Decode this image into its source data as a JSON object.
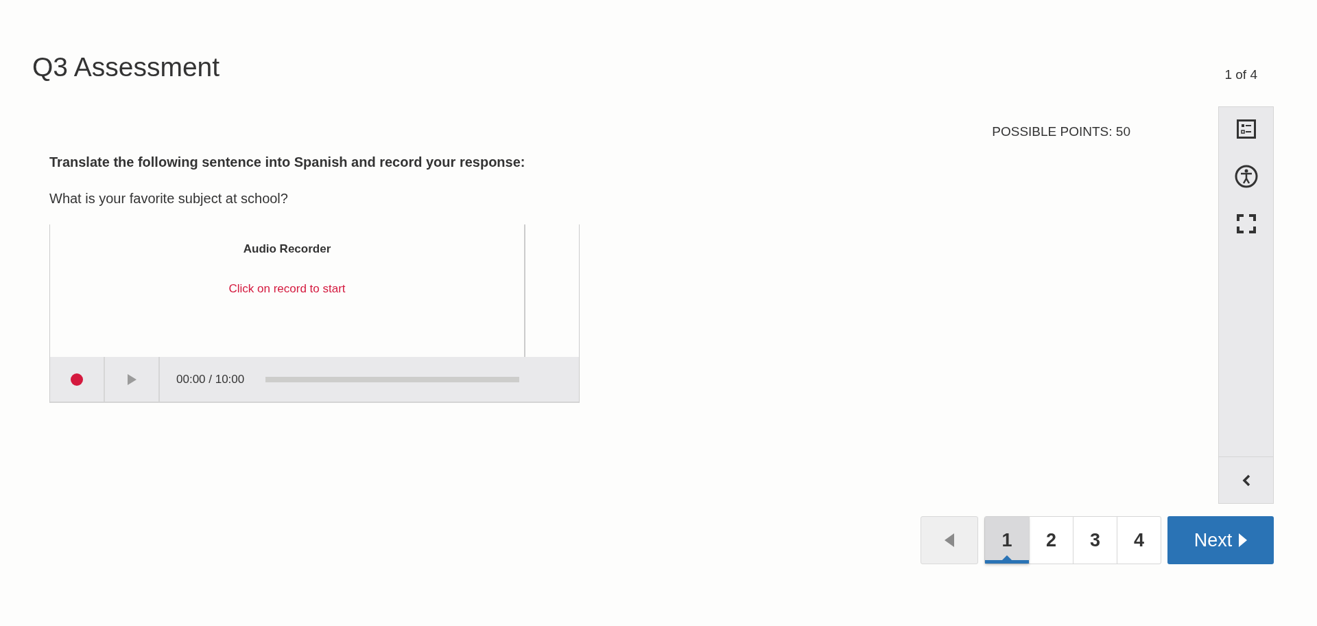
{
  "title": "Q3 Assessment",
  "progress": "1 of 4",
  "possible_points": "POSSIBLE POINTS: 50",
  "instruction": "Translate the following sentence into Spanish and record your response:",
  "question": "What is your favorite subject at school?",
  "recorder": {
    "title": "Audio Recorder",
    "status": "Click on record to start",
    "time": "00:00 / 10:00"
  },
  "previous_button": {
    "disabled": true
  },
  "pages": [
    {
      "label": "1",
      "selected": true
    },
    {
      "label": "2",
      "selected": false
    },
    {
      "label": "3",
      "selected": false
    },
    {
      "label": "4",
      "selected": false
    }
  ],
  "next_button": "Next"
}
